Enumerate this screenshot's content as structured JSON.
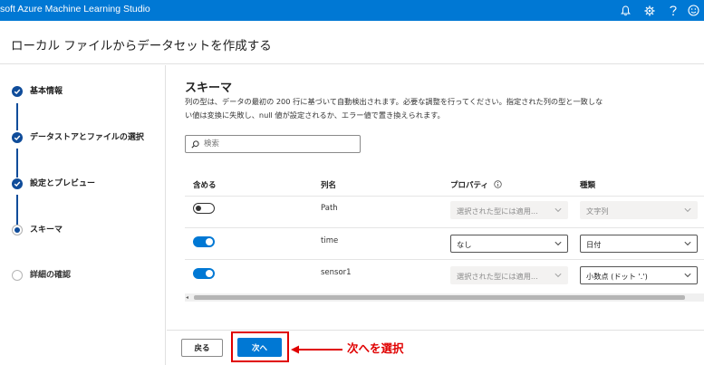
{
  "app": {
    "title": "soft Azure Machine Learning Studio"
  },
  "topbar_icons": [
    "bell-icon",
    "gear-icon",
    "help-icon",
    "feedback-smiley-icon"
  ],
  "page": {
    "title": "ローカル ファイルからデータセットを作成する"
  },
  "steps": [
    {
      "label": "基本情報",
      "state": "done"
    },
    {
      "label": "データストアとファイルの選択",
      "state": "done"
    },
    {
      "label": "設定とプレビュー",
      "state": "done"
    },
    {
      "label": "スキーマ",
      "state": "current"
    },
    {
      "label": "詳細の確認",
      "state": "todo"
    }
  ],
  "schema": {
    "title": "スキーマ",
    "description_line1": "列の型は、データの最初の 200 行に基づいて自動検出されます。必要な調整を行ってください。指定された列の型と一致しな",
    "description_line2": "い値は変換に失敗し、null 値が設定されるか、エラー値で置き換えられます。",
    "search_placeholder": "検索"
  },
  "table": {
    "headers": {
      "include": "含める",
      "column_name": "列名",
      "properties": "プロパティ",
      "type": "種類"
    },
    "rows": [
      {
        "include": false,
        "name": "Path",
        "property": "選択された型には適用...",
        "property_enabled": false,
        "type": "文字列",
        "type_enabled": false
      },
      {
        "include": true,
        "name": "time",
        "property": "なし",
        "property_enabled": true,
        "type": "日付",
        "type_enabled": true
      },
      {
        "include": true,
        "name": "sensor1",
        "property": "選択された型には適用...",
        "property_enabled": false,
        "type": "小数点 (ドット '.')",
        "type_enabled": true
      }
    ]
  },
  "footer": {
    "back_label": "戻る",
    "next_label": "次へ"
  },
  "annotation": {
    "text": "次へを選択",
    "color": "#e00000"
  },
  "colors": {
    "accent": "#0078d4",
    "step_done": "#0f4c9a"
  }
}
